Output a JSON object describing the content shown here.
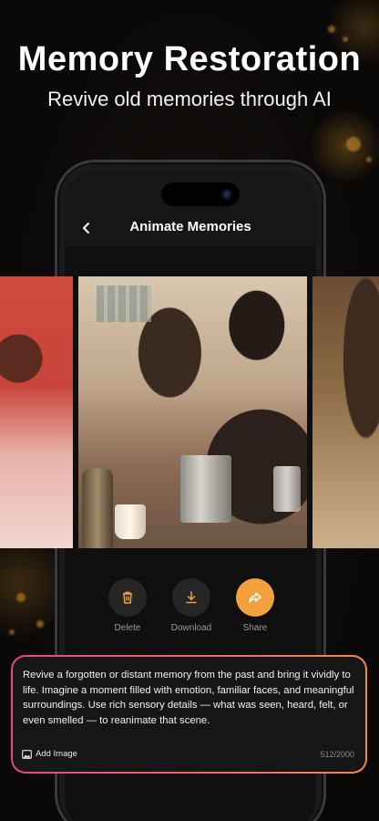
{
  "header": {
    "title": "Memory Restoration",
    "subtitle": "Revive old memories through AI"
  },
  "screen": {
    "title": "Animate Memories",
    "back_icon": "chevron-left-icon"
  },
  "actions": [
    {
      "label": "Delete",
      "icon": "trash-icon"
    },
    {
      "label": "Download",
      "icon": "download-icon"
    },
    {
      "label": "Share",
      "icon": "share-icon"
    }
  ],
  "prompt": {
    "text": "Revive a forgotten or distant memory from the past and bring it vividly to life. Imagine a moment filled with emotion, familiar faces, and meaningful surroundings. Use rich sensory details — what was seen, heard, felt, or even smelled — to reanimate that scene.",
    "add_image_label": "Add Image",
    "counter": "512/2000"
  },
  "colors": {
    "accent": "#f2a13c",
    "gradient_start": "#e8458c",
    "gradient_end": "#f08a4b",
    "background": "#0b0908"
  }
}
